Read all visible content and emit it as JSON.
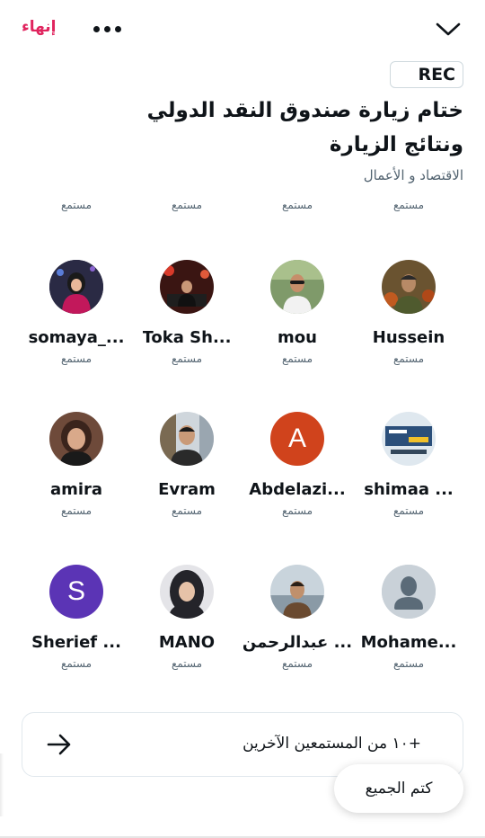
{
  "header": {
    "end_label": "إنهاء",
    "more_icon": "more-horizontal-icon",
    "collapse_icon": "chevron-down-icon"
  },
  "space": {
    "rec_badge": "REC",
    "title": "ختام زيارة صندوق النقد الدولي ونتائج الزيارة",
    "topic": "الاقتصاد و الأعمال"
  },
  "partial_row": {
    "roles": [
      "مستمع",
      "مستمع",
      "مستمع",
      "مستمع"
    ]
  },
  "listeners": [
    {
      "name": "somaya_...",
      "role": "مستمع",
      "avatar": "photo",
      "color": "#c2185b"
    },
    {
      "name": "Toka Sh...",
      "role": "مستمع",
      "avatar": "photo",
      "color": "#4a1a16"
    },
    {
      "name": "mou",
      "role": "مستمع",
      "avatar": "photo",
      "color": "#6d8a5a"
    },
    {
      "name": "Hussein",
      "role": "مستمع",
      "avatar": "photo",
      "color": "#5a4a2e"
    },
    {
      "name": "amira",
      "role": "مستمع",
      "avatar": "photo",
      "color": "#8a5a44"
    },
    {
      "name": "Evram",
      "role": "مستمع",
      "avatar": "photo",
      "color": "#3d3d3d"
    },
    {
      "name": "Abdelazi...",
      "role": "مستمع",
      "avatar": "letter",
      "letter": "A",
      "color": "#d0431c"
    },
    {
      "name": "shimaa ...",
      "role": "مستمع",
      "avatar": "photo",
      "color": "#2b4f7a"
    },
    {
      "name": "Sherief ...",
      "role": "مستمع",
      "avatar": "letter",
      "letter": "S",
      "color": "#5b34b5"
    },
    {
      "name": "MANO",
      "role": "مستمع",
      "avatar": "photo",
      "color": "#2f2f33"
    },
    {
      "name": "عبدالرحمن ...",
      "role": "مستمع",
      "avatar": "photo",
      "color": "#7a5e45"
    },
    {
      "name": "Mohame...",
      "role": "مستمع",
      "avatar": "default",
      "color": "#c9d1d8"
    }
  ],
  "more_listeners": {
    "label": "+١٠ من المستمعين الآخرين",
    "icon": "arrow-right-icon"
  },
  "mute_all": {
    "label": "كتم الجميع"
  }
}
